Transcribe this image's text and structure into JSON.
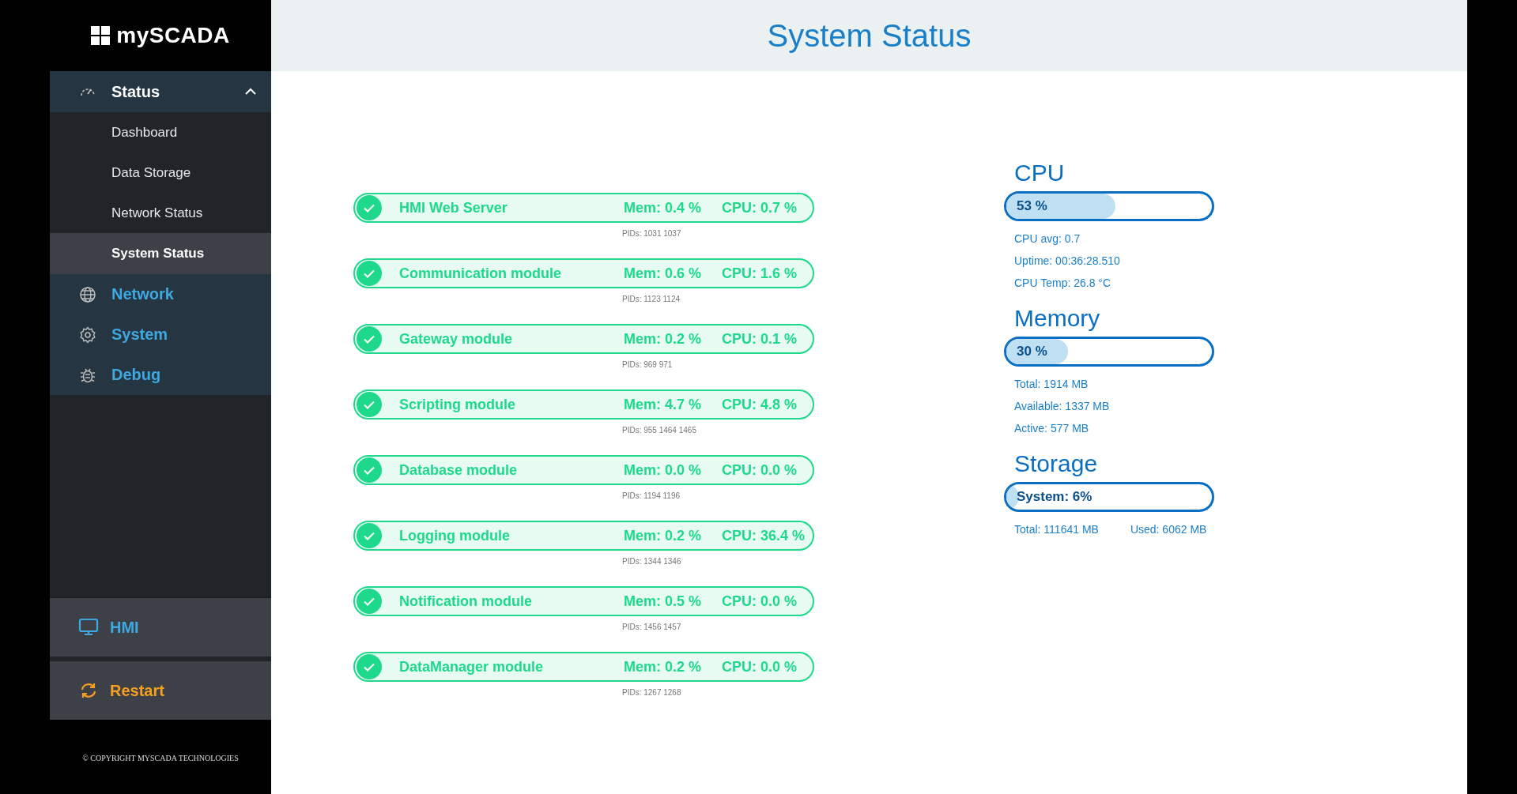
{
  "sidebar": {
    "logo": "mySCADA",
    "groups": [
      {
        "label": "Status",
        "kind": "gauge",
        "expanded": true,
        "children": [
          {
            "label": "Dashboard",
            "selected": false
          },
          {
            "label": "Data Storage",
            "selected": false
          },
          {
            "label": "Network Status",
            "selected": false
          },
          {
            "label": "System Status",
            "selected": true
          }
        ]
      },
      {
        "label": "Network",
        "kind": "globe"
      },
      {
        "label": "System",
        "kind": "gear"
      },
      {
        "label": "Debug",
        "kind": "bug"
      }
    ],
    "actions": [
      {
        "label": "HMI",
        "kind": "hmi"
      },
      {
        "label": "Restart",
        "kind": "restart"
      }
    ],
    "copyright": "© COPYRIGHT MYSCADA TECHNOLOGIES"
  },
  "header": {
    "title": "System Status"
  },
  "modules": [
    {
      "name": "HMI Web Server",
      "running": true,
      "mem": "Mem: 0.4 %",
      "cpu": "CPU: 0.7 %",
      "pids": "PIDs: 1031 1037"
    },
    {
      "name": "Communication module",
      "running": true,
      "mem": "Mem: 0.6 %",
      "cpu": "CPU: 1.6 %",
      "pids": "PIDs: 1123 1124"
    },
    {
      "name": "Gateway module",
      "running": true,
      "mem": "Mem: 0.2 %",
      "cpu": "CPU: 0.1 %",
      "pids": "PIDs: 969 971"
    },
    {
      "name": "Scripting module",
      "running": true,
      "mem": "Mem: 4.7 %",
      "cpu": "CPU: 4.8 %",
      "pids": "PIDs: 955 1464 1465"
    },
    {
      "name": "Database module",
      "running": true,
      "mem": "Mem: 0.0 %",
      "cpu": "CPU: 0.0 %",
      "pids": "PIDs: 1194 1196"
    },
    {
      "name": "Logging module",
      "running": true,
      "mem": "Mem: 0.2 %",
      "cpu": "CPU: 36.4 %",
      "pids": "PIDs: 1344 1346"
    },
    {
      "name": "Notification module",
      "running": true,
      "mem": "Mem: 0.5 %",
      "cpu": "CPU: 0.0 %",
      "pids": "PIDs: 1456 1457"
    },
    {
      "name": "DataManager module",
      "running": true,
      "mem": "Mem: 0.2 %",
      "cpu": "CPU: 0.0 %",
      "pids": "PIDs: 1267 1268"
    }
  ],
  "resources": [
    {
      "title": "CPU",
      "level": 0.53,
      "reading": "53 %",
      "details": [
        "CPU avg: 0.7",
        "Uptime: 00:36:28.510",
        "CPU Temp: 26.8 °C"
      ],
      "kind": "list"
    },
    {
      "title": "Memory",
      "level": 0.3,
      "reading": "30 %",
      "details": [
        "Total: 1914 MB",
        "Available: 1337 MB",
        "Active: 577 MB"
      ],
      "kind": "list"
    },
    {
      "title": "Storage",
      "level": 0.06,
      "reading": "System: 6%",
      "details": [
        "Total: 111641 MB",
        "Used: 6062 MB"
      ],
      "kind": "row"
    }
  ]
}
